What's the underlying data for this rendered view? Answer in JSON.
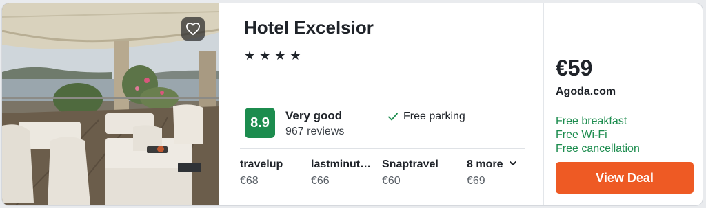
{
  "hotel": {
    "name": "Hotel Excelsior",
    "star_rating": 4,
    "star_glyphs": [
      "★",
      "★",
      "★",
      "★"
    ]
  },
  "rating": {
    "score": "8.9",
    "label": "Very good",
    "reviews": "967 reviews",
    "color": "#1c8c4e"
  },
  "amenity": {
    "icon": "checkmark-icon",
    "label": "Free parking"
  },
  "providers": [
    {
      "name": "travelup",
      "price": "€68"
    },
    {
      "name": "lastminut…",
      "price": "€66"
    },
    {
      "name": "Snaptravel",
      "price": "€60"
    },
    {
      "name": "8 more",
      "price": "€69",
      "icon": "chevron-down-icon"
    }
  ],
  "deal": {
    "price": "€59",
    "source": "Agoda.com",
    "perks": [
      "Free breakfast",
      "Free Wi-Fi",
      "Free cancellation"
    ],
    "perk_color": "#1c8c4e",
    "button_label": "View Deal",
    "button_color": "#ee5a24"
  },
  "icons": {
    "favorite": "heart-outline-icon"
  }
}
